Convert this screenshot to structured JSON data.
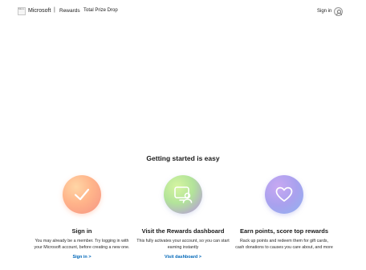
{
  "header": {
    "logo_alt": "Micro",
    "brand": "Microsoft",
    "separator": "|",
    "nav_rewards": "Rewards",
    "nav_prize": "Total Prize Drop",
    "signin": "Sign in"
  },
  "section": {
    "title": "Getting started is easy"
  },
  "cards": [
    {
      "title": "Sign in",
      "desc": "You may already be a member. Try logging in with your Microsoft account, before creating a new one.",
      "link": "Sign in >",
      "icon": "checkmark-icon",
      "color": "#f59384"
    },
    {
      "title": "Visit the Rewards dashboard",
      "desc": "This fully activates your account, so you can start earning instantly",
      "link": "Visit dashboard >",
      "icon": "dashboard-user-icon",
      "color": "#b2e39a"
    },
    {
      "title": "Earn points, score top rewards",
      "desc": "Rack up points and redeem them for gift cards, cash donations to causes you care about, and more",
      "icon": "heart-icon",
      "color": "#a9a1ee"
    }
  ],
  "colors": {
    "link": "#0067b8",
    "text": "#1b1b1b"
  }
}
